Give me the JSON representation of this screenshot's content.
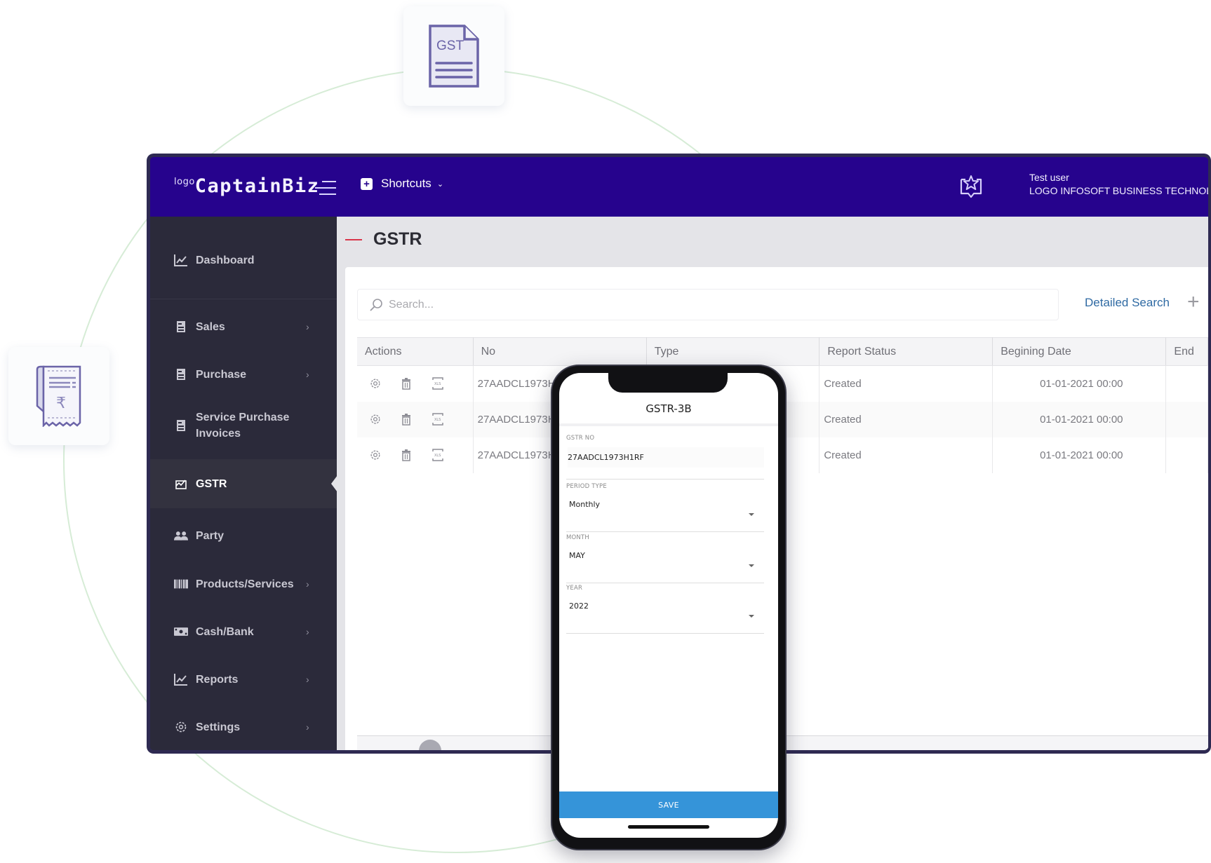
{
  "decor": {
    "gst_card_icon": "gst-document-icon",
    "gst_card_text": "GST",
    "receipt_card_icon": "rupee-receipt-icon",
    "receipt_currency_symbol": "₹"
  },
  "header": {
    "logo_prefix": "logo",
    "logo_name": "CaptainBiz",
    "menu_icon": "hamburger-menu-icon",
    "shortcuts_label": "Shortcuts",
    "notifications_icon": "star-bubble-icon",
    "user_name": "Test user",
    "company_name": "LOGO INFOSOFT BUSINESS TECHNOL"
  },
  "sidebar": {
    "items": [
      {
        "label": "Dashboard",
        "icon": "chart-line-icon",
        "has_submenu": false
      },
      {
        "label": "Sales",
        "icon": "document-icon",
        "has_submenu": true
      },
      {
        "label": "Purchase",
        "icon": "document-icon",
        "has_submenu": true
      },
      {
        "label": "Service Purchase\nInvoices",
        "icon": "document-icon",
        "has_submenu": false
      },
      {
        "label": "GSTR",
        "icon": "gstr-chart-icon",
        "has_submenu": false,
        "active": true
      },
      {
        "label": "Party",
        "icon": "users-icon",
        "has_submenu": false
      },
      {
        "label": "Products/Services",
        "icon": "barcode-icon",
        "has_submenu": true
      },
      {
        "label": "Cash/Bank",
        "icon": "cash-icon",
        "has_submenu": true
      },
      {
        "label": "Reports",
        "icon": "chart-line-icon",
        "has_submenu": true
      },
      {
        "label": "Settings",
        "icon": "gear-icon",
        "has_submenu": true
      }
    ],
    "arrow": "›"
  },
  "main": {
    "page_title": "GSTR",
    "search_placeholder": "Search...",
    "detailed_search_label": "Detailed Search",
    "add_symbol": "+",
    "table": {
      "columns": [
        "Actions",
        "No",
        "Type",
        "Report Status",
        "Begining Date",
        "End"
      ],
      "rows": [
        {
          "no": "27AADCL1973H",
          "type": "",
          "status": "Created",
          "begin": "01-01-2021 00:00",
          "end": ""
        },
        {
          "no": "27AADCL1973H",
          "type": "",
          "status": "Created",
          "begin": "01-01-2021 00:00",
          "end": ""
        },
        {
          "no": "27AADCL1973H",
          "type": "",
          "status": "Created",
          "begin": "01-01-2021 00:00",
          "end": ""
        }
      ],
      "row_actions": [
        "gear-icon",
        "trash-icon",
        "xls-export-icon"
      ]
    }
  },
  "mobile": {
    "title": "GSTR-3B",
    "fields": [
      {
        "label": "GSTR NO",
        "value": "27AADCL1973H1RF",
        "dropdown": false
      },
      {
        "label": "PERIOD TYPE",
        "value": "Monthly",
        "dropdown": true
      },
      {
        "label": "MONTH",
        "value": "MAY",
        "dropdown": true
      },
      {
        "label": "YEAR",
        "value": "2022",
        "dropdown": true
      }
    ],
    "save_label": "SAVE"
  },
  "colors": {
    "header_bg": "#26038d",
    "sidebar_bg": "#2b2a3a",
    "link_blue": "#2f6aa3",
    "save_blue": "#3594d9",
    "title_accent": "#d9364a",
    "icon_purple": "#6b64a8"
  }
}
